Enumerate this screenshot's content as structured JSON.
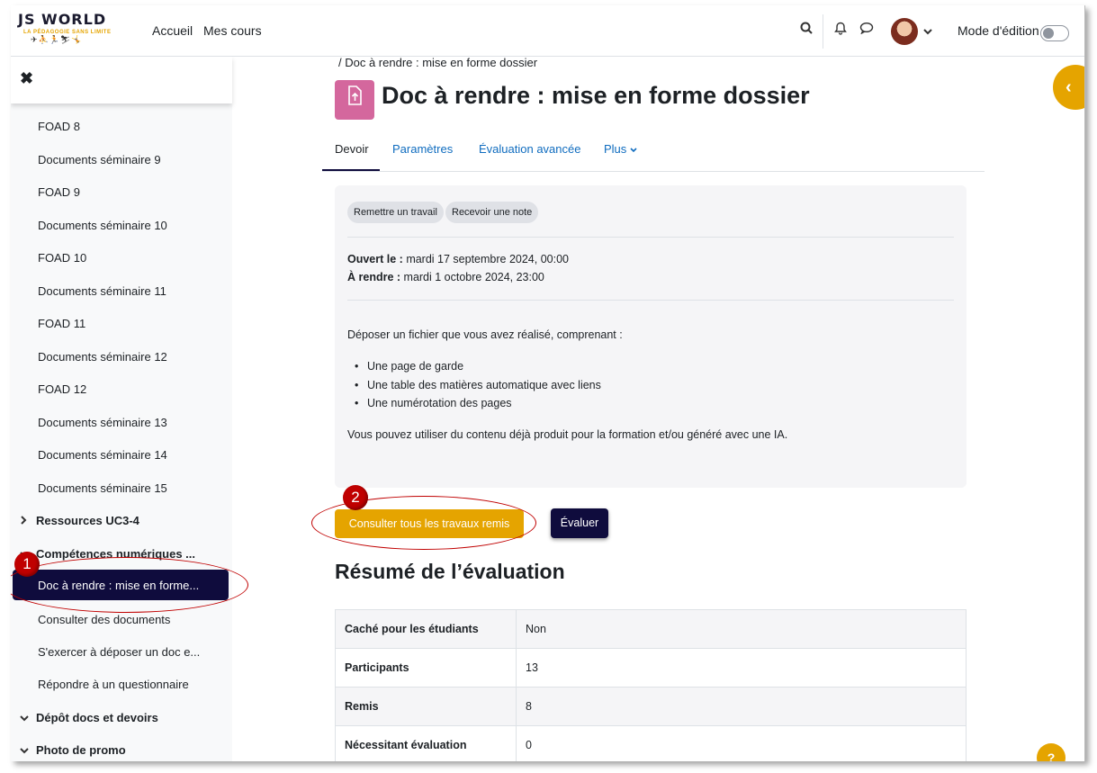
{
  "header": {
    "logo_main": "JS WORLD",
    "logo_tagline": "LA PÉDAGOGIE SANS LIMITE",
    "logo_figures": "✈⛹🏃⛷🤸",
    "nav": [
      "Accueil",
      "Mes cours"
    ],
    "edit_mode_label": "Mode d'édition"
  },
  "drawer": {
    "items": [
      "FOAD 8",
      "Documents séminaire 9",
      "FOAD 9",
      "Documents séminaire 10",
      "FOAD 10",
      "Documents séminaire 11",
      "FOAD 11",
      "Documents séminaire 12",
      "FOAD 12",
      "Documents séminaire 13",
      "Documents séminaire 14",
      "Documents séminaire 15"
    ],
    "section_ressources": "Ressources UC3-4",
    "section_competences": "Compétences numériques ...",
    "active_item": "Doc à rendre : mise en forme...",
    "sub_items": [
      "Consulter des documents",
      "S'exercer à déposer un doc e...",
      "Répondre à un questionnaire"
    ],
    "section_depot": "Dépôt docs et devoirs",
    "section_photo": "Photo de promo",
    "marker1": "1"
  },
  "main": {
    "breadcrumb": "/ Doc à rendre : mise en forme dossier",
    "title": "Doc à rendre : mise en forme dossier",
    "tabs": [
      "Devoir",
      "Paramètres",
      "Évaluation avancée",
      "Plus"
    ],
    "pills": [
      "Remettre un travail",
      "Recevoir une note"
    ],
    "opened_label": "Ouvert le :",
    "opened_value": "mardi 17 septembre 2024, 00:00",
    "due_label": "À rendre :",
    "due_value": "mardi 1 octobre 2024, 23:00",
    "intro": "Déposer un fichier que vous avez réalisé, comprenant :",
    "bullets": [
      "Une page de garde",
      "Une table des matières automatique avec liens",
      "Une numérotation des pages"
    ],
    "note": "Vous pouvez utiliser du contenu déjà produit pour la formation et/ou généré avec une IA.",
    "btn_view_all": "Consulter tous les travaux remis",
    "btn_grade": "Évaluer",
    "marker2": "2",
    "summary_title": "Résumé de l’évaluation",
    "summary": [
      {
        "k": "Caché pour les étudiants",
        "v": "Non"
      },
      {
        "k": "Participants",
        "v": "13"
      },
      {
        "k": "Remis",
        "v": "8"
      },
      {
        "k": "Nécessitant évaluation",
        "v": "0"
      }
    ]
  },
  "colors": {
    "accent": "#e5a400",
    "primary_dark": "#0f0c3d",
    "link": "#0f6cbf",
    "activity_icon": "#d4679d",
    "annotation": "#c00000"
  }
}
